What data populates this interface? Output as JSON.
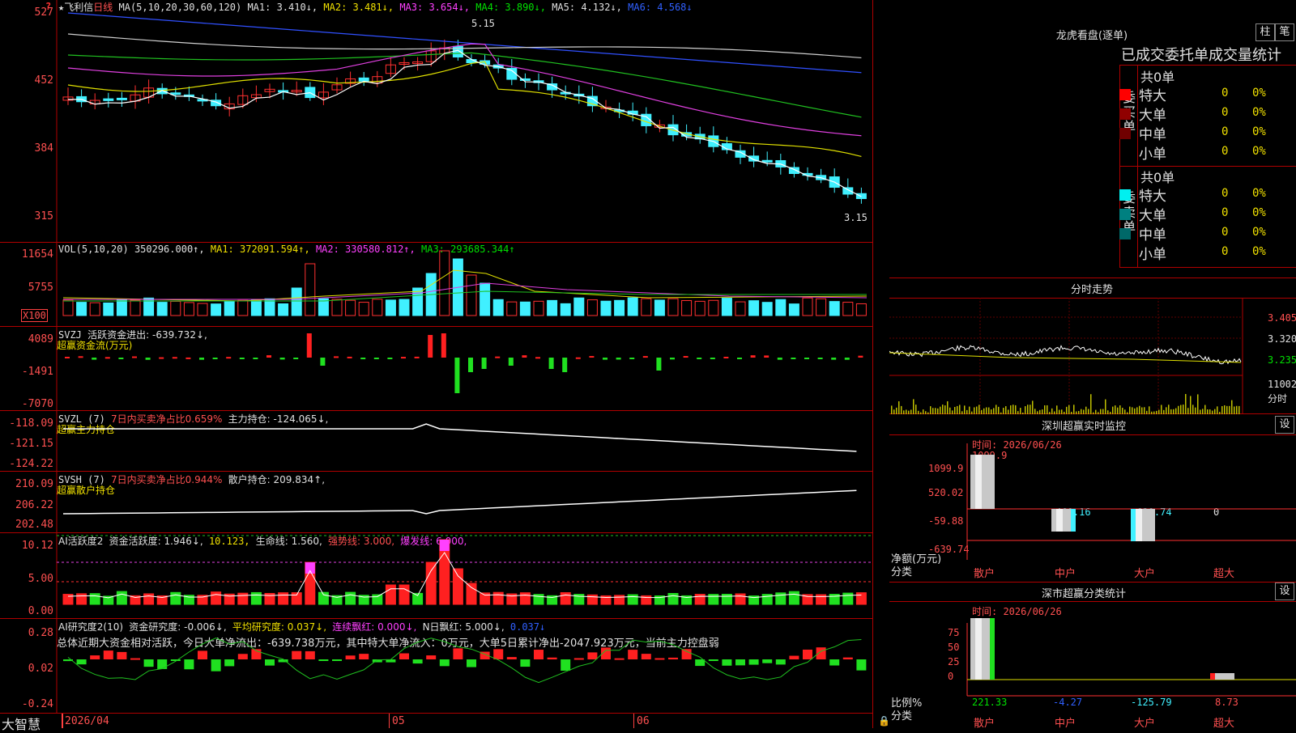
{
  "stock": {
    "star": "★",
    "name": "飞利信",
    "period": "日线",
    "ma_params": "MA(5,10,20,30,60,120)",
    "ma1": "MA1: 3.410↓,",
    "ma2": "MA2: 3.481↓,",
    "ma3": "MA3: 3.654↓,",
    "ma4": "MA4: 3.890↓,",
    "ma5": "MA5: 4.132↓,",
    "ma6": "MA6: 4.568↓",
    "high_note": "5.15",
    "low_note": "3.15",
    "price_ticks": [
      "527",
      "452",
      "384",
      "315"
    ]
  },
  "vol": {
    "label": "VOL(5,10,20)",
    "value": "350296.000↑,",
    "ma1": "MA1: 372091.594↑,",
    "ma2": "MA2: 330580.812↑,",
    "ma3": "MA3: 293685.344↑",
    "ticks": [
      "11654",
      "5755"
    ],
    "unit": "X100"
  },
  "svzj": {
    "label": "SVZJ",
    "text": "活跃资金进出: -639.732↓,",
    "sub": "超赢资金流(万元)",
    "ticks": [
      "4089",
      "-1491",
      "-7070"
    ]
  },
  "svzl": {
    "label": "SVZL (7)",
    "ratio": "7日内买卖净占比0.659%",
    "text": "主力持仓: -124.065↓,",
    "sub": "超赢主力持仓",
    "ticks": [
      "-118.09",
      "-121.15",
      "-124.22"
    ]
  },
  "svsh": {
    "label": "SVSH (7)",
    "ratio": "7日内买卖净占比0.944%",
    "text": "散户持仓: 209.834↑,",
    "sub": "超赢散户持仓",
    "ticks": [
      "210.09",
      "206.22",
      "202.48"
    ]
  },
  "ai1": {
    "label": "AI活跃度2",
    "text1": "资金活跃度: 1.946↓,",
    "text2": "10.123,",
    "text3": "生命线: 1.560,",
    "text4": "强势线: 3.000,",
    "text5": "爆发线: 6.000,",
    "ticks": [
      "10.12",
      "5.00",
      "0.00"
    ]
  },
  "ai2": {
    "label": "AI研究度2(10)",
    "t1": "资金研究度: -0.006↓,",
    "t2": "平均研究度: 0.037↓,",
    "t3": "连续飘红: 0.000↓,",
    "t4": "N日飘红: 5.000↓,",
    "t5": "0.037↓",
    "summary": "总体近期大资金相对活跃，今日大单净流出：-639.738万元，其中特大单净流入：0万元，大单5日累计净出-2047.923万元，当前主力控盘弱",
    "ticks": [
      "0.28",
      "0.02",
      "-0.24"
    ]
  },
  "bottom": {
    "brand": "大智慧",
    "date1": "2026/04",
    "date2": "05",
    "date3": "06"
  },
  "longhu": {
    "title": "龙虎看盘(逐单)",
    "btn1": "柱",
    "btn2": "笔",
    "sub": "已成交委托单成交量统计",
    "buy_total": "共0单",
    "buy_label": "委买单",
    "sell_total": "共0单",
    "sell_label": "委卖单",
    "rows": [
      {
        "name": "特大",
        "v": "0",
        "p": "0%"
      },
      {
        "name": "大单",
        "v": "0",
        "p": "0%"
      },
      {
        "name": "中单",
        "v": "0",
        "p": "0%"
      },
      {
        "name": "小单",
        "v": "0",
        "p": "0%"
      }
    ],
    "buy_colors": [
      "#ff0000",
      "#900000",
      "#700000",
      ""
    ],
    "sell_colors": [
      "#00f0f0",
      "#008080",
      "#006868",
      ""
    ]
  },
  "fenshi": {
    "title": "分时走势",
    "ticks": [
      "3.405",
      "3.320",
      "3.235"
    ],
    "vol_tick": "11002",
    "unit": "分时"
  },
  "sz_monitor": {
    "title": "深圳超赢实时监控",
    "btn": "设",
    "time": "时间: 2026/06/26",
    "ticks": [
      "1099.9",
      "520.02",
      "-59.88",
      "-639.74"
    ],
    "top_label": "1099.9",
    "values": [
      "-460.16",
      "-639.74",
      "0"
    ],
    "y_label": "净额(万元)",
    "x_label": "分类",
    "cats": [
      "散户",
      "中户",
      "大户",
      "超大"
    ]
  },
  "sz_stats": {
    "title": "深市超赢分类统计",
    "btn": "设",
    "time": "时间: 2026/06/26",
    "ticks": [
      "75",
      "50",
      "25",
      "0"
    ],
    "values": [
      "221.33",
      "-4.27",
      "-125.79",
      "8.73"
    ],
    "y_label": "比例%",
    "x_label": "分类",
    "cats": [
      "散户",
      "中户",
      "大户",
      "超大"
    ]
  }
}
